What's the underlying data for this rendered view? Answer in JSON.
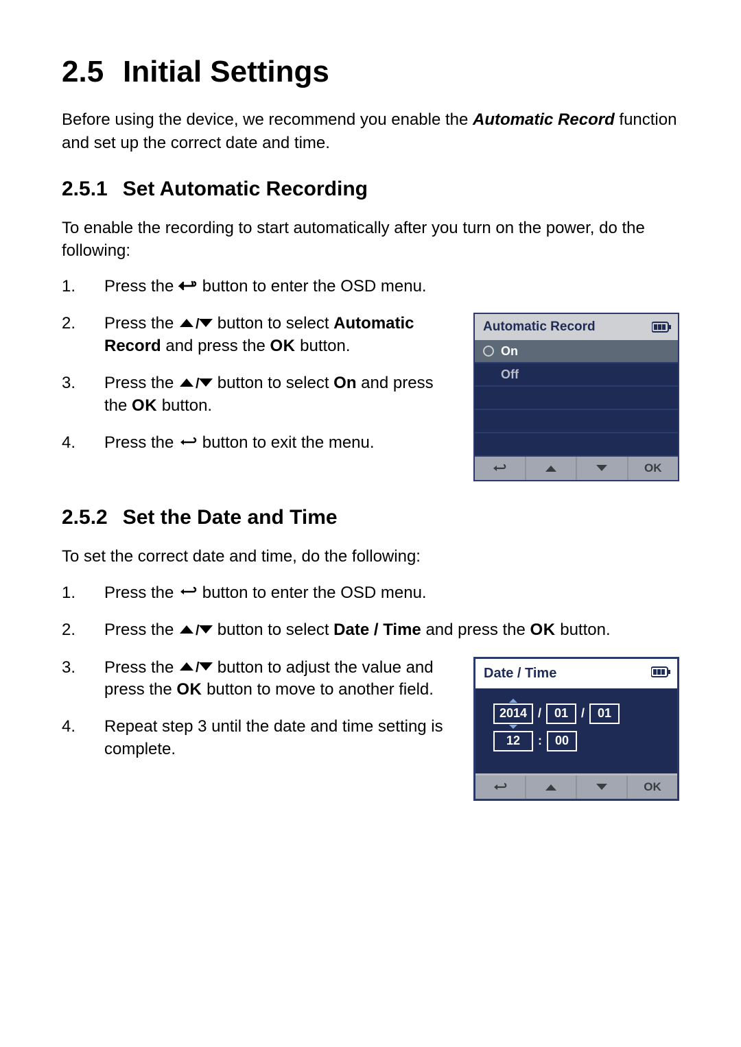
{
  "heading": {
    "num": "2.5",
    "title": "Initial Settings"
  },
  "intro": {
    "pre": "Before using the device, we recommend you enable the ",
    "bi": "Automatic Record",
    "post": " function and set up the correct date and time."
  },
  "sec1": {
    "num": "2.5.1",
    "title": "Set Automatic Recording",
    "para": "To enable the recording to start automatically after you turn on the power, do the following:",
    "steps": {
      "s1n": "1.",
      "s1a": "Press the ",
      "s1b": " button to enter the OSD menu.",
      "s2n": "2.",
      "s2a": "Press the ",
      "s2b": " button to select ",
      "s2c": "Automatic Record",
      "s2d": " and press the ",
      "s2e": " button.",
      "s3n": "3.",
      "s3a": "Press the ",
      "s3b": " button to select ",
      "s3c": "On",
      "s3d": " and press the ",
      "s3e": " button.",
      "s4n": "4.",
      "s4a": "Press the ",
      "s4b": " button to exit the menu."
    },
    "osd": {
      "title": "Automatic Record",
      "on": "On",
      "off": "Off",
      "ok": "OK"
    }
  },
  "sec2": {
    "num": "2.5.2",
    "title": "Set the Date and Time",
    "para": "To set the correct date and time, do the following:",
    "steps": {
      "s1n": "1.",
      "s1a": "Press the ",
      "s1b": " button to enter the OSD menu.",
      "s2n": "2.",
      "s2a": "Press the ",
      "s2b": " button to select ",
      "s2c": "Date / Time",
      "s2d": " and press the ",
      "s2e": " button.",
      "s3n": "3.",
      "s3a": "Press the ",
      "s3b": " button to adjust the value and press the ",
      "s3c": " button to move to another field.",
      "s4n": "4.",
      "s4t": "Repeat step 3 until the date and time setting is complete."
    },
    "osd": {
      "title": "Date / Time",
      "year": "2014",
      "month": "01",
      "day": "01",
      "hour": "12",
      "minute": "00",
      "slash": "/",
      "colon": ":",
      "ok": "OK"
    }
  },
  "ok_label": "OK"
}
